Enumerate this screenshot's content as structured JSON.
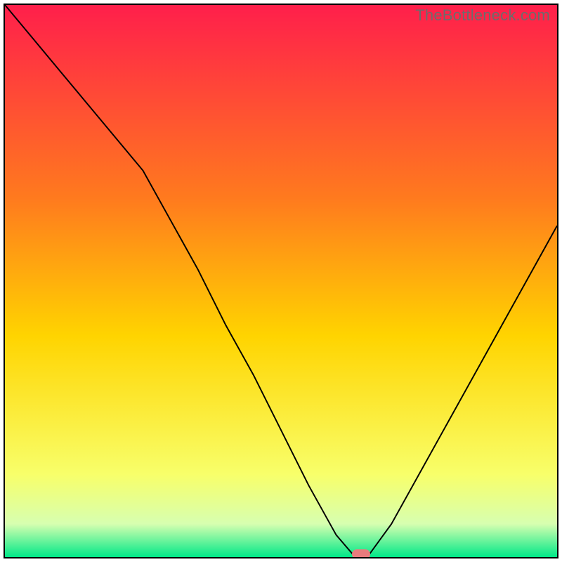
{
  "watermark": "TheBottleneck.com",
  "chart_data": {
    "type": "line",
    "title": "",
    "xlabel": "",
    "ylabel": "",
    "xlim": [
      0,
      100
    ],
    "ylim": [
      0,
      100
    ],
    "x": [
      0,
      5,
      10,
      15,
      20,
      25,
      30,
      35,
      40,
      45,
      50,
      55,
      60,
      63,
      66,
      70,
      75,
      80,
      85,
      90,
      95,
      100
    ],
    "y": [
      100,
      94,
      88,
      82,
      76,
      70,
      61,
      52,
      42,
      33,
      23,
      13,
      4,
      0.5,
      0.5,
      6,
      15,
      24,
      33,
      42,
      51,
      60
    ],
    "colors": {
      "top": "#ff1f4b",
      "upper": "#ff7a1e",
      "mid": "#ffd400",
      "lower": "#f8ff6a",
      "band": "#d7ffb0",
      "bottom": "#00e888",
      "curve": "#000000",
      "marker": "#e87b7d"
    },
    "marker_point": {
      "x": 64.5,
      "y": 0.5
    }
  }
}
